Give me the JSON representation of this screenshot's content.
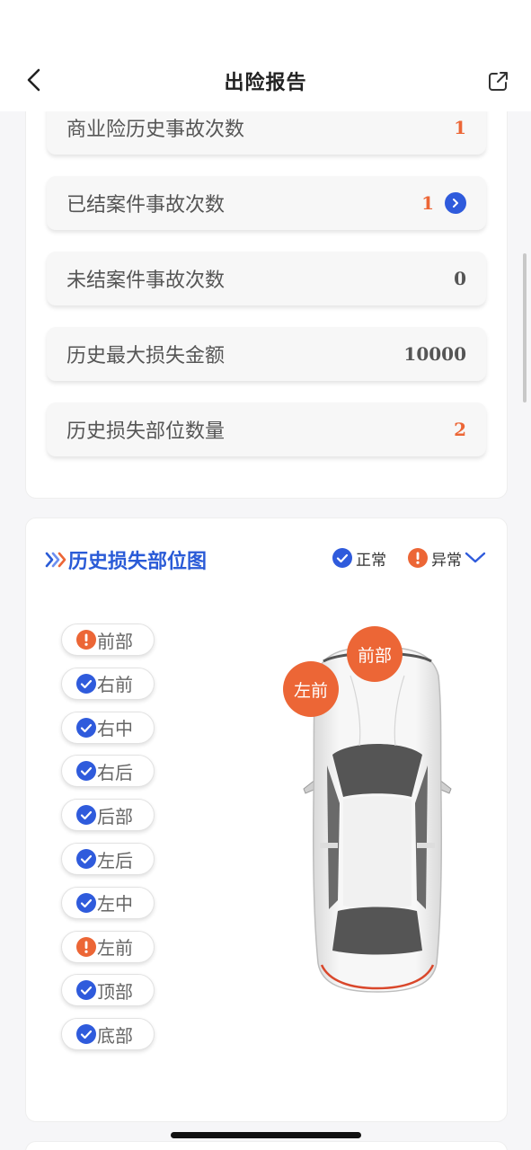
{
  "header": {
    "title": "出险报告"
  },
  "stats": {
    "commercial_history": {
      "label": "商业险历史事故次数",
      "value": "1"
    },
    "closed_cases": {
      "label": "已结案件事故次数",
      "value": "1"
    },
    "open_cases": {
      "label": "未结案件事故次数",
      "value": "0"
    },
    "max_loss": {
      "label": "历史最大损失金额",
      "value": "10000"
    },
    "damaged_parts_count": {
      "label": "历史损失部位数量",
      "value": "2"
    }
  },
  "damage_map": {
    "title": "历史损失部位图",
    "legend": {
      "normal": "正常",
      "abnormal": "异常"
    },
    "parts": [
      {
        "label": "前部",
        "status": "abnormal"
      },
      {
        "label": "右前",
        "status": "normal"
      },
      {
        "label": "右中",
        "status": "normal"
      },
      {
        "label": "右后",
        "status": "normal"
      },
      {
        "label": "后部",
        "status": "normal"
      },
      {
        "label": "左后",
        "status": "normal"
      },
      {
        "label": "左中",
        "status": "normal"
      },
      {
        "label": "左前",
        "status": "abnormal"
      },
      {
        "label": "顶部",
        "status": "normal"
      },
      {
        "label": "底部",
        "status": "normal"
      }
    ],
    "markers": {
      "front": "前部",
      "left_front": "左前"
    }
  },
  "colors": {
    "accent": "#2f5bdc",
    "abnormal": "#ec6636",
    "title_blue": "#2a5bd7"
  }
}
